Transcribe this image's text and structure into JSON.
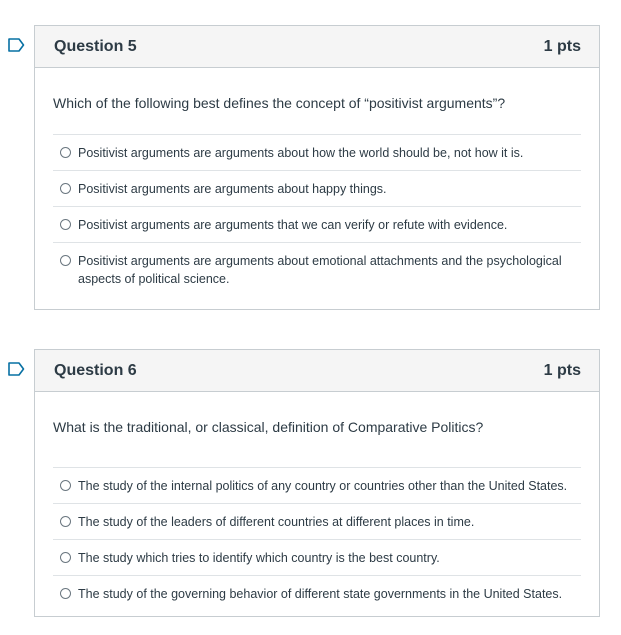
{
  "questions": [
    {
      "title": "Question 5",
      "points": "1 pts",
      "text": "Which of the following best defines the concept of “positivist arguments”?",
      "answers": [
        "Positivist arguments are arguments about how the world should be, not how it is.",
        "Positivist arguments are arguments about happy things.",
        "Positivist arguments are arguments that we can verify or refute with evidence.",
        "Positivist arguments are arguments about emotional attachments and the psychological aspects of political science."
      ]
    },
    {
      "title": "Question 6",
      "points": "1 pts",
      "text": "What is the traditional, or classical, definition of Comparative Politics?",
      "answers": [
        "The study of the internal politics of any country or countries other than the United States.",
        "The study of the leaders of different countries at different places in time.",
        "The study which tries to identify which country is the best country.",
        "The study of the governing behavior of different state governments in the United States."
      ]
    }
  ],
  "colors": {
    "flag": "#0770a3",
    "border": "#c7cdd1",
    "header_bg": "#f5f5f5",
    "text": "#2d3b45"
  },
  "icons": {
    "flag": "bookmark-flag-icon",
    "radio": "radio-button-icon"
  }
}
